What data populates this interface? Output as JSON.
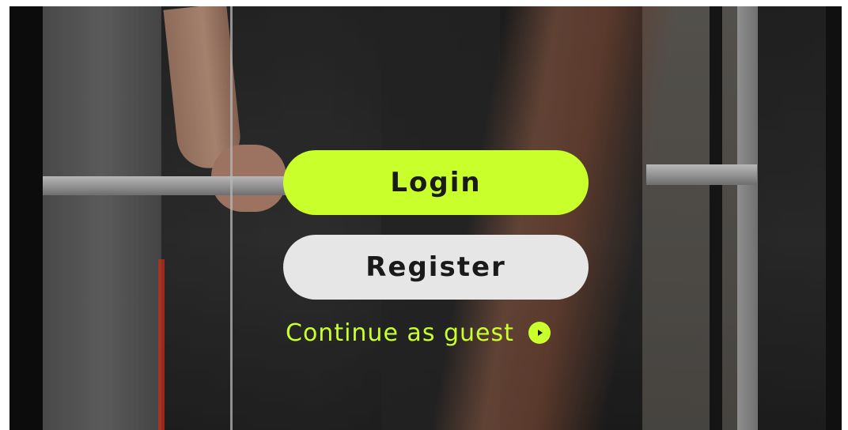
{
  "auth": {
    "login_label": "Login",
    "register_label": "Register",
    "guest_label": "Continue as guest"
  },
  "icons": {
    "guest_icon": "play-circle-icon"
  },
  "colors": {
    "accent": "#c9ff2a",
    "secondary_button": "#e7e6e6",
    "text_dark": "#1a1a1a"
  }
}
